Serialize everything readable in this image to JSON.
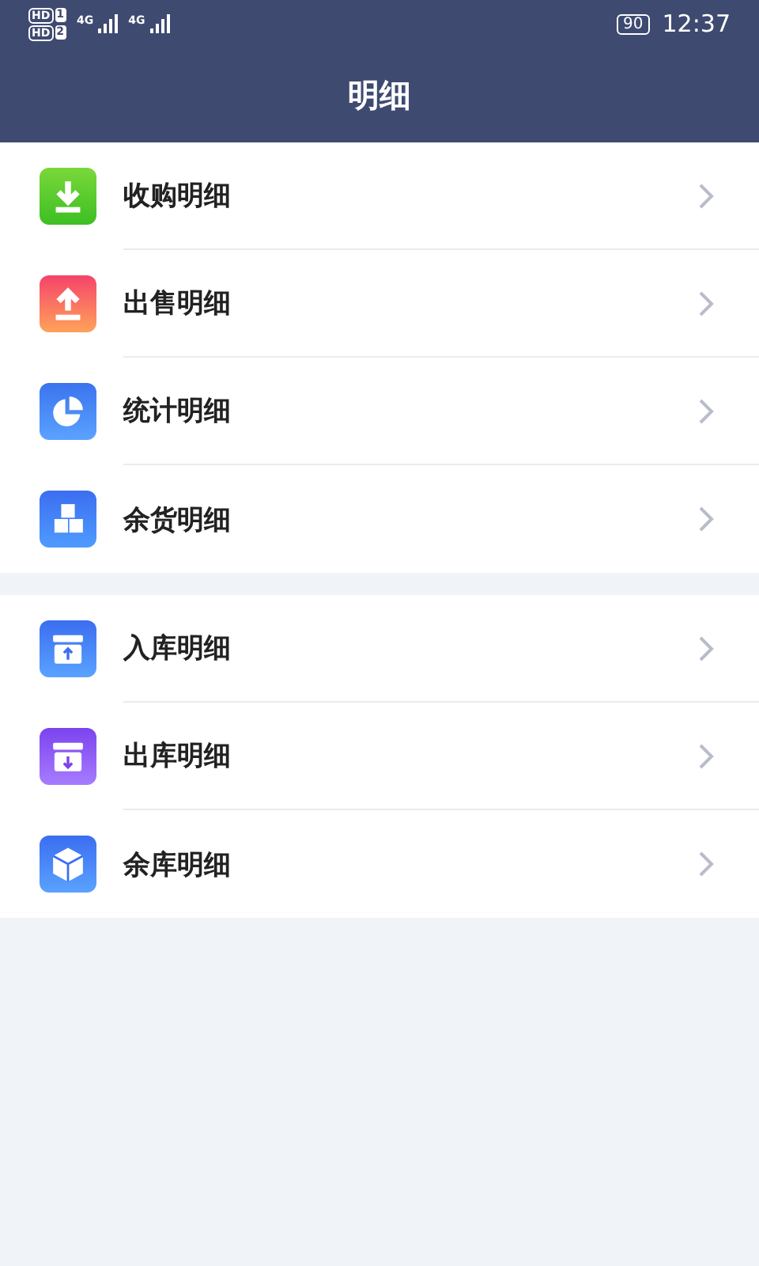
{
  "status_bar": {
    "sims": [
      {
        "badge": "HD",
        "slot": "1"
      },
      {
        "badge": "HD",
        "slot": "2"
      }
    ],
    "networks": [
      "4G",
      "4G"
    ],
    "battery": "90",
    "time": "12:37"
  },
  "header": {
    "title": "明细"
  },
  "groups": [
    {
      "items": [
        {
          "kind": "download",
          "label": "收购明细"
        },
        {
          "kind": "upload",
          "label": "出售明细"
        },
        {
          "kind": "pie",
          "label": "统计明细"
        },
        {
          "kind": "blocks",
          "label": "余货明细"
        }
      ]
    },
    {
      "items": [
        {
          "kind": "inbox-in",
          "label": "入库明细"
        },
        {
          "kind": "inbox-out",
          "label": "出库明细"
        },
        {
          "kind": "cube",
          "label": "余库明细"
        }
      ]
    }
  ]
}
